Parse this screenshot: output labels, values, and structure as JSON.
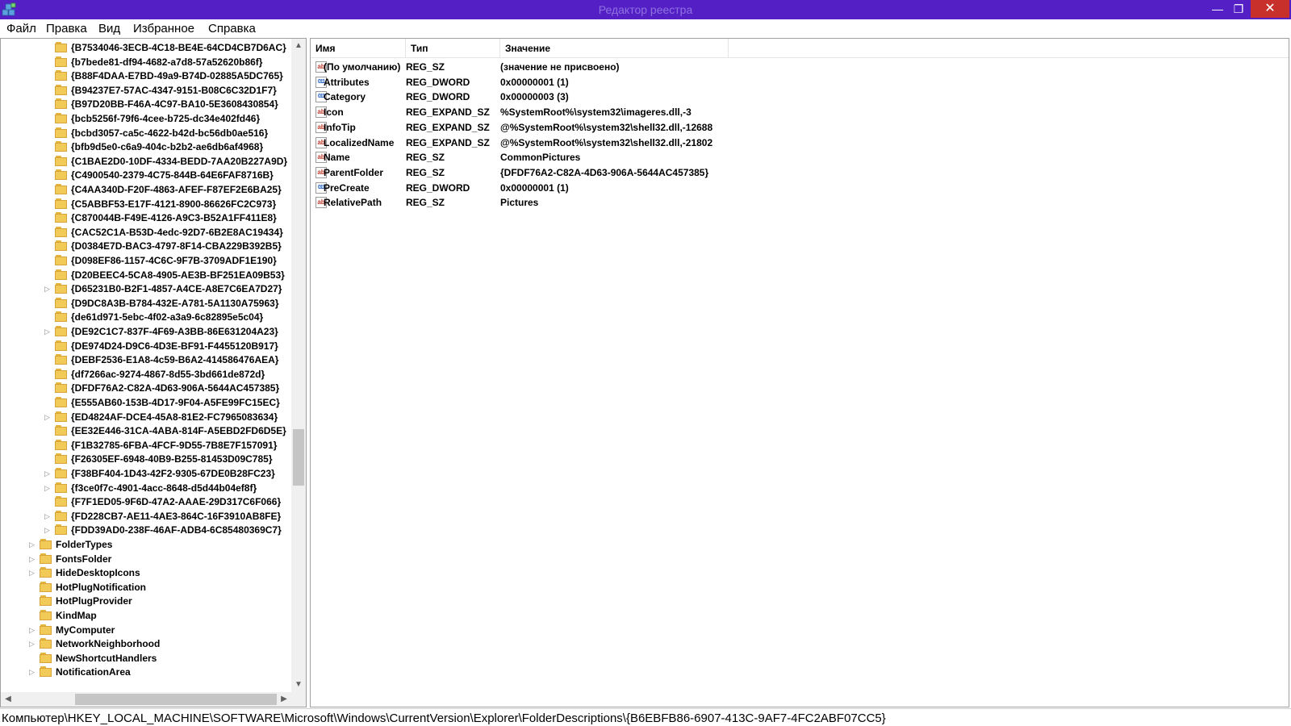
{
  "window": {
    "title": "Редактор реестра",
    "controls": {
      "minimize": "—",
      "maximize": "❐",
      "close": "✕"
    }
  },
  "menu": [
    "Файл",
    "Правка",
    "Вид",
    "Избранное",
    "Справка"
  ],
  "tree": {
    "items": [
      {
        "label": "{B7534046-3ECB-4C18-BE4E-64CD4CB7D6AC}",
        "level": 2,
        "expandable": false
      },
      {
        "label": "{b7bede81-df94-4682-a7d8-57a52620b86f}",
        "level": 2,
        "expandable": false
      },
      {
        "label": "{B88F4DAA-E7BD-49a9-B74D-02885A5DC765}",
        "level": 2,
        "expandable": false
      },
      {
        "label": "{B94237E7-57AC-4347-9151-B08C6C32D1F7}",
        "level": 2,
        "expandable": false
      },
      {
        "label": "{B97D20BB-F46A-4C97-BA10-5E3608430854}",
        "level": 2,
        "expandable": false
      },
      {
        "label": "{bcb5256f-79f6-4cee-b725-dc34e402fd46}",
        "level": 2,
        "expandable": false
      },
      {
        "label": "{bcbd3057-ca5c-4622-b42d-bc56db0ae516}",
        "level": 2,
        "expandable": false
      },
      {
        "label": "{bfb9d5e0-c6a9-404c-b2b2-ae6db6af4968}",
        "level": 2,
        "expandable": false
      },
      {
        "label": "{C1BAE2D0-10DF-4334-BEDD-7AA20B227A9D}",
        "level": 2,
        "expandable": false
      },
      {
        "label": "{C4900540-2379-4C75-844B-64E6FAF8716B}",
        "level": 2,
        "expandable": false
      },
      {
        "label": "{C4AA340D-F20F-4863-AFEF-F87EF2E6BA25}",
        "level": 2,
        "expandable": false
      },
      {
        "label": "{C5ABBF53-E17F-4121-8900-86626FC2C973}",
        "level": 2,
        "expandable": false
      },
      {
        "label": "{C870044B-F49E-4126-A9C3-B52A1FF411E8}",
        "level": 2,
        "expandable": false
      },
      {
        "label": "{CAC52C1A-B53D-4edc-92D7-6B2E8AC19434}",
        "level": 2,
        "expandable": false
      },
      {
        "label": "{D0384E7D-BAC3-4797-8F14-CBA229B392B5}",
        "level": 2,
        "expandable": false
      },
      {
        "label": "{D098EF86-1157-4C6C-9F7B-3709ADF1E190}",
        "level": 2,
        "expandable": false
      },
      {
        "label": "{D20BEEC4-5CA8-4905-AE3B-BF251EA09B53}",
        "level": 2,
        "expandable": false
      },
      {
        "label": "{D65231B0-B2F1-4857-A4CE-A8E7C6EA7D27}",
        "level": 2,
        "expandable": true
      },
      {
        "label": "{D9DC8A3B-B784-432E-A781-5A1130A75963}",
        "level": 2,
        "expandable": false
      },
      {
        "label": "{de61d971-5ebc-4f02-a3a9-6c82895e5c04}",
        "level": 2,
        "expandable": false
      },
      {
        "label": "{DE92C1C7-837F-4F69-A3BB-86E631204A23}",
        "level": 2,
        "expandable": true
      },
      {
        "label": "{DE974D24-D9C6-4D3E-BF91-F4455120B917}",
        "level": 2,
        "expandable": false
      },
      {
        "label": "{DEBF2536-E1A8-4c59-B6A2-414586476AEA}",
        "level": 2,
        "expandable": false
      },
      {
        "label": "{df7266ac-9274-4867-8d55-3bd661de872d}",
        "level": 2,
        "expandable": false
      },
      {
        "label": "{DFDF76A2-C82A-4D63-906A-5644AC457385}",
        "level": 2,
        "expandable": false
      },
      {
        "label": "{E555AB60-153B-4D17-9F04-A5FE99FC15EC}",
        "level": 2,
        "expandable": false
      },
      {
        "label": "{ED4824AF-DCE4-45A8-81E2-FC7965083634}",
        "level": 2,
        "expandable": true
      },
      {
        "label": "{EE32E446-31CA-4ABA-814F-A5EBD2FD6D5E}",
        "level": 2,
        "expandable": false
      },
      {
        "label": "{F1B32785-6FBA-4FCF-9D55-7B8E7F157091}",
        "level": 2,
        "expandable": false
      },
      {
        "label": "{F26305EF-6948-40B9-B255-81453D09C785}",
        "level": 2,
        "expandable": false
      },
      {
        "label": "{F38BF404-1D43-42F2-9305-67DE0B28FC23}",
        "level": 2,
        "expandable": true
      },
      {
        "label": "{f3ce0f7c-4901-4acc-8648-d5d44b04ef8f}",
        "level": 2,
        "expandable": true
      },
      {
        "label": "{F7F1ED05-9F6D-47A2-AAAE-29D317C6F066}",
        "level": 2,
        "expandable": false
      },
      {
        "label": "{FD228CB7-AE11-4AE3-864C-16F3910AB8FE}",
        "level": 2,
        "expandable": true
      },
      {
        "label": "{FDD39AD0-238F-46AF-ADB4-6C85480369C7}",
        "level": 2,
        "expandable": true
      },
      {
        "label": "FolderTypes",
        "level": 1,
        "expandable": true
      },
      {
        "label": "FontsFolder",
        "level": 1,
        "expandable": true
      },
      {
        "label": "HideDesktopIcons",
        "level": 1,
        "expandable": true
      },
      {
        "label": "HotPlugNotification",
        "level": 1,
        "expandable": false
      },
      {
        "label": "HotPlugProvider",
        "level": 1,
        "expandable": false
      },
      {
        "label": "KindMap",
        "level": 1,
        "expandable": false
      },
      {
        "label": "MyComputer",
        "level": 1,
        "expandable": true
      },
      {
        "label": "NetworkNeighborhood",
        "level": 1,
        "expandable": true
      },
      {
        "label": "NewShortcutHandlers",
        "level": 1,
        "expandable": false
      },
      {
        "label": "NotificationArea",
        "level": 1,
        "expandable": true
      }
    ]
  },
  "list": {
    "columns": [
      "Имя",
      "Тип",
      "Значение"
    ],
    "rows": [
      {
        "name": "(По умолчанию)",
        "type": "REG_SZ",
        "value": "(значение не присвоено)",
        "icon": "string-value-icon",
        "glyph": "ab"
      },
      {
        "name": "Attributes",
        "type": "REG_DWORD",
        "value": "0x00000001 (1)",
        "icon": "binary-value-icon",
        "glyph": "011"
      },
      {
        "name": "Category",
        "type": "REG_DWORD",
        "value": "0x00000003 (3)",
        "icon": "binary-value-icon",
        "glyph": "011"
      },
      {
        "name": "Icon",
        "type": "REG_EXPAND_SZ",
        "value": "%SystemRoot%\\system32\\imageres.dll,-3",
        "icon": "string-value-icon",
        "glyph": "ab"
      },
      {
        "name": "InfoTip",
        "type": "REG_EXPAND_SZ",
        "value": "@%SystemRoot%\\system32\\shell32.dll,-12688",
        "icon": "string-value-icon",
        "glyph": "ab"
      },
      {
        "name": "LocalizedName",
        "type": "REG_EXPAND_SZ",
        "value": "@%SystemRoot%\\system32\\shell32.dll,-21802",
        "icon": "string-value-icon",
        "glyph": "ab"
      },
      {
        "name": "Name",
        "type": "REG_SZ",
        "value": "CommonPictures",
        "icon": "string-value-icon",
        "glyph": "ab"
      },
      {
        "name": "ParentFolder",
        "type": "REG_SZ",
        "value": "{DFDF76A2-C82A-4D63-906A-5644AC457385}",
        "icon": "string-value-icon",
        "glyph": "ab"
      },
      {
        "name": "PreCreate",
        "type": "REG_DWORD",
        "value": "0x00000001 (1)",
        "icon": "binary-value-icon",
        "glyph": "011"
      },
      {
        "name": "RelativePath",
        "type": "REG_SZ",
        "value": "Pictures",
        "icon": "string-value-icon",
        "glyph": "ab"
      }
    ]
  },
  "scroll": {
    "up": "▲",
    "down": "▼",
    "left": "◀",
    "right": "▶"
  },
  "status": {
    "path": "Компьютер\\HKEY_LOCAL_MACHINE\\SOFTWARE\\Microsoft\\Windows\\CurrentVersion\\Explorer\\FolderDescriptions\\{B6EBFB86-6907-413C-9AF7-4FC2ABF07CC5}"
  },
  "colors": {
    "titlebar": "#5420c6",
    "close_button": "#c7302b",
    "folder": "#f2ca58"
  }
}
